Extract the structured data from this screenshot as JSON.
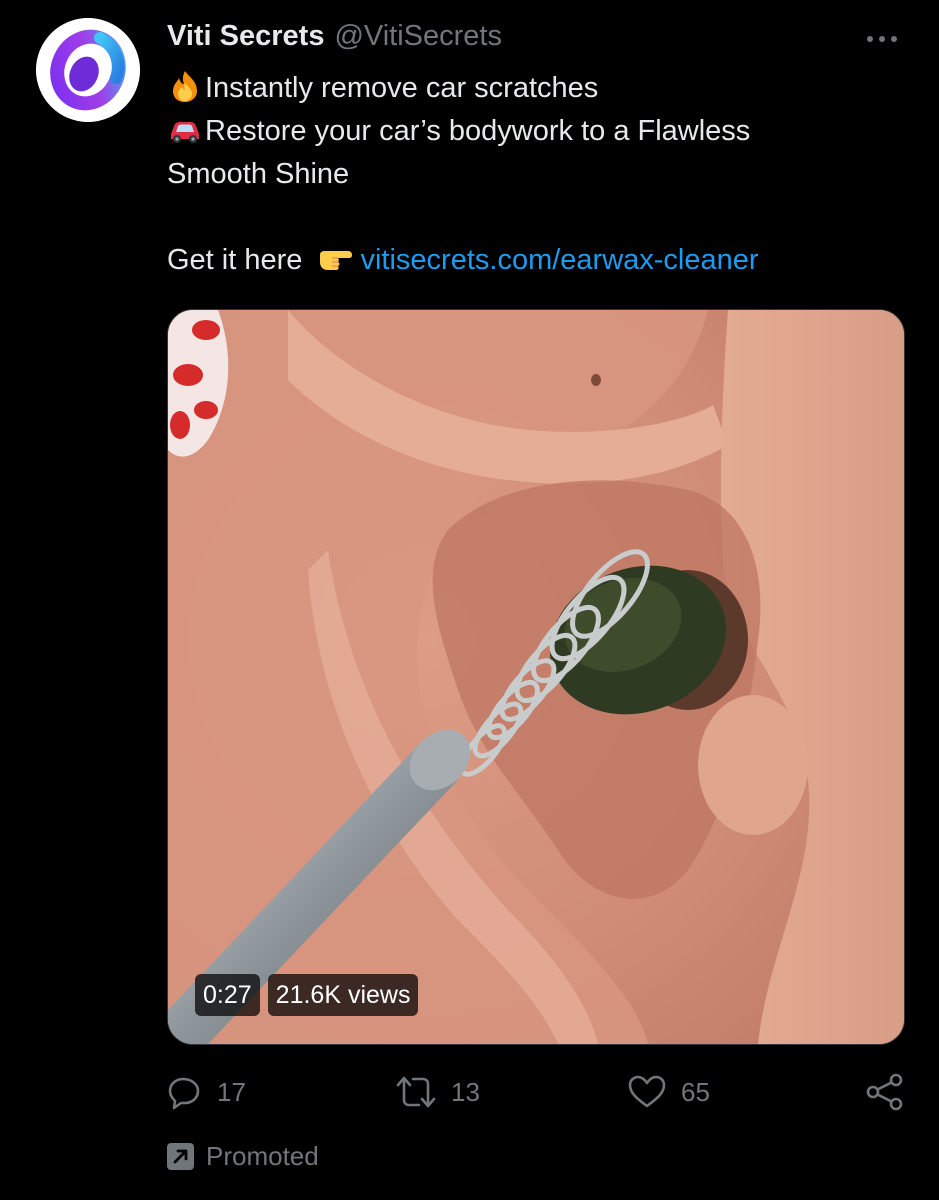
{
  "account": {
    "display_name": "Viti Secrets",
    "handle": "@VitiSecrets",
    "avatar_icon": "logo-ring-icon"
  },
  "menu": {
    "more_icon": "more-dots-icon"
  },
  "tweet": {
    "line1_emoji": "fire-icon",
    "line1_text": "Instantly remove car scratches",
    "line2_emoji": "car-icon",
    "line2_text": "Restore your car’s bodywork to a Flawless",
    "line3_text": "Smooth Shine",
    "line4_text": "Get it here",
    "line4_emoji": "pointing-hand-icon",
    "link_text": "vitisecrets.com/earwax-cleaner"
  },
  "media": {
    "duration": "0:27",
    "views": "21.6K views"
  },
  "actions": {
    "reply_count": "17",
    "retweet_count": "13",
    "like_count": "65"
  },
  "promoted": {
    "label": "Promoted"
  },
  "colors": {
    "background": "#000000",
    "text": "#e7e9ea",
    "secondary": "#71767b",
    "link": "#1d9bf0"
  }
}
